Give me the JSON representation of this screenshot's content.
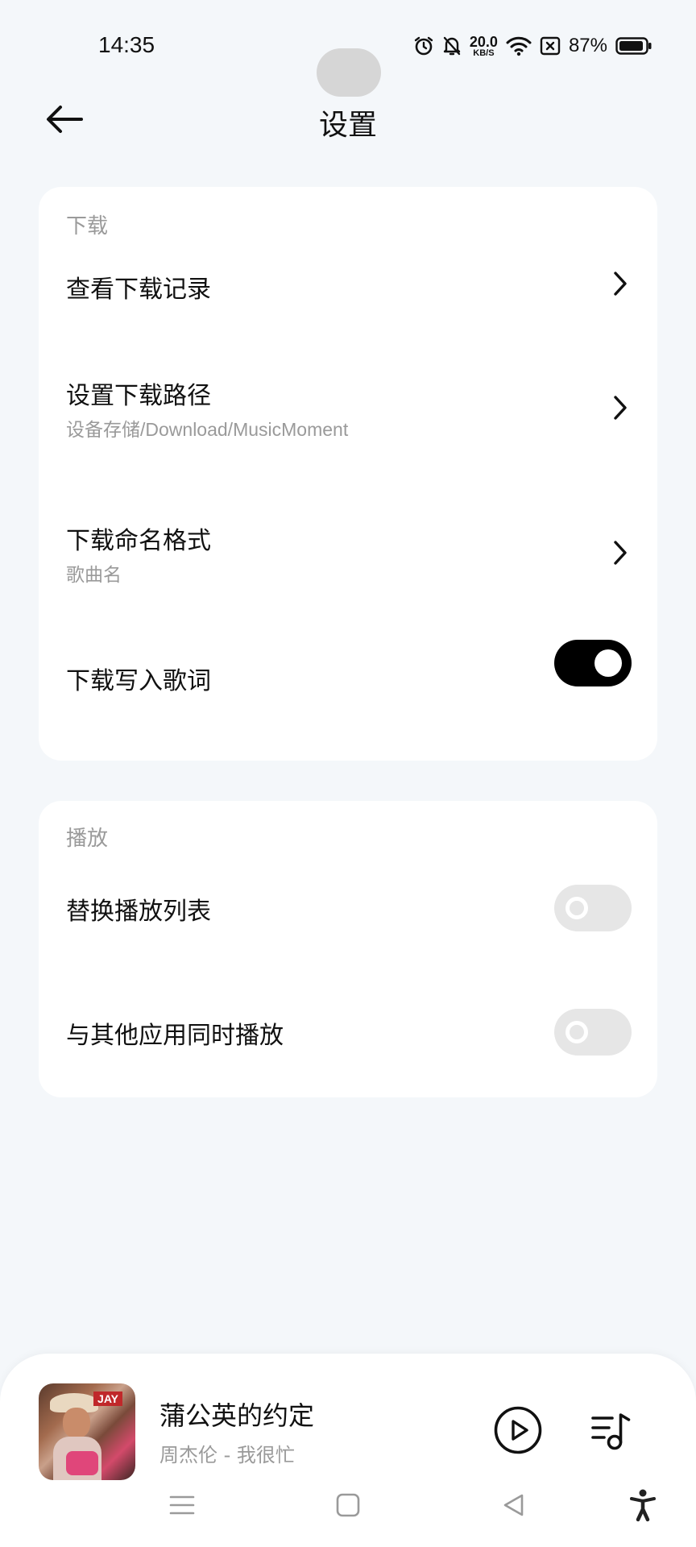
{
  "status_bar": {
    "time": "14:35",
    "speed_value": "20.0",
    "speed_unit": "KB/S",
    "battery": "87%",
    "icons": [
      "alarm-icon",
      "bell-off-icon",
      "wifi-icon",
      "no-sim-icon",
      "battery-icon"
    ]
  },
  "header": {
    "title": "设置",
    "back_icon": "arrow-left-icon"
  },
  "download": {
    "section": "下载",
    "items": [
      {
        "title": "查看下载记录"
      },
      {
        "title": "设置下载路径",
        "subtitle": "设备存储/Download/MusicMoment"
      },
      {
        "title": "下载命名格式",
        "subtitle": "歌曲名"
      },
      {
        "title": "下载写入歌词",
        "toggle": true
      }
    ]
  },
  "playback": {
    "section": "播放",
    "items": [
      {
        "title": "替换播放列表",
        "toggle": false
      },
      {
        "title": "与其他应用同时播放",
        "toggle": false
      }
    ]
  },
  "player": {
    "song_title": "蒲公英的约定",
    "song_subtitle": "周杰伦 - 我很忙",
    "album_tag": "JAY",
    "play_icon": "play-icon",
    "playlist_icon": "playlist-icon"
  },
  "navbar": {
    "icons": [
      "menu-icon",
      "home-square-icon",
      "back-triangle-icon",
      "accessibility-icon"
    ]
  },
  "colors": {
    "background": "#f4f7fa",
    "card": "#ffffff",
    "toggle_on": "#000000",
    "toggle_off": "#e6e6e6",
    "secondary_text": "#9a9a9a"
  }
}
